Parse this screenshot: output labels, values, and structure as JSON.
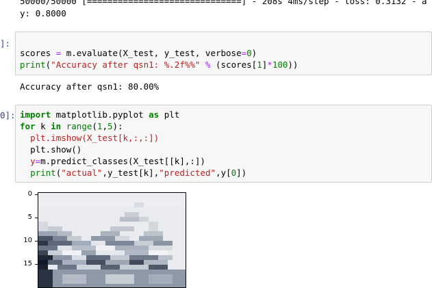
{
  "output1": {
    "progress_line": "50000/50000 [==============================] - 208s 4ms/step - loss: 0.3132 - a",
    "result_line": "y: 0.8000"
  },
  "cell1": {
    "prompt": "]:",
    "code": {
      "line1": {
        "var": "scores",
        "op": " = ",
        "call": "m.evaluate(X_test, y_test, verbose",
        "eq": "=",
        "zero": "0",
        "close": ")"
      },
      "line2": {
        "print": "print",
        "open": "(",
        "str": "\"Accuracy after qsn1: %.2f%%\"",
        "mod": " % ",
        "rest1": "(scores[",
        "one": "1",
        "rest2": "]",
        "mul": "*",
        "hundred": "100",
        "rest3": "))"
      }
    },
    "output": "Accuracy after qsn1: 80.00%"
  },
  "cell2": {
    "prompt": "0]:",
    "code": {
      "line1": {
        "import": "import",
        "module": " matplotlib.pyplot ",
        "as": "as",
        "alias": " plt"
      },
      "line2": {
        "for": "for",
        "k": " k ",
        "in": "in",
        "range": " range",
        "args_open": "(",
        "one": "1",
        "comma": ",",
        "five": "5",
        "args_close": "):"
      },
      "line3": {
        "indent": "  ",
        "text": "plt.imshow(X_test[k,:,:])"
      },
      "line4": {
        "indent": "  ",
        "text": "plt.show()"
      },
      "line5": {
        "indent": "  ",
        "y": "y",
        "eq": "=",
        "rest": "m.predict_classes(X_test[[k],:])"
      },
      "line6": {
        "indent": "  ",
        "print": "print",
        "open": "(",
        "s1": "\"actual\"",
        "mid": ",y_test[k],",
        "s2": "\"predicted\"",
        "mid2": ",y[",
        "zero": "0",
        "close": "])"
      }
    }
  },
  "plot": {
    "y_ticks": [
      "0",
      "5",
      "10",
      "15"
    ]
  }
}
